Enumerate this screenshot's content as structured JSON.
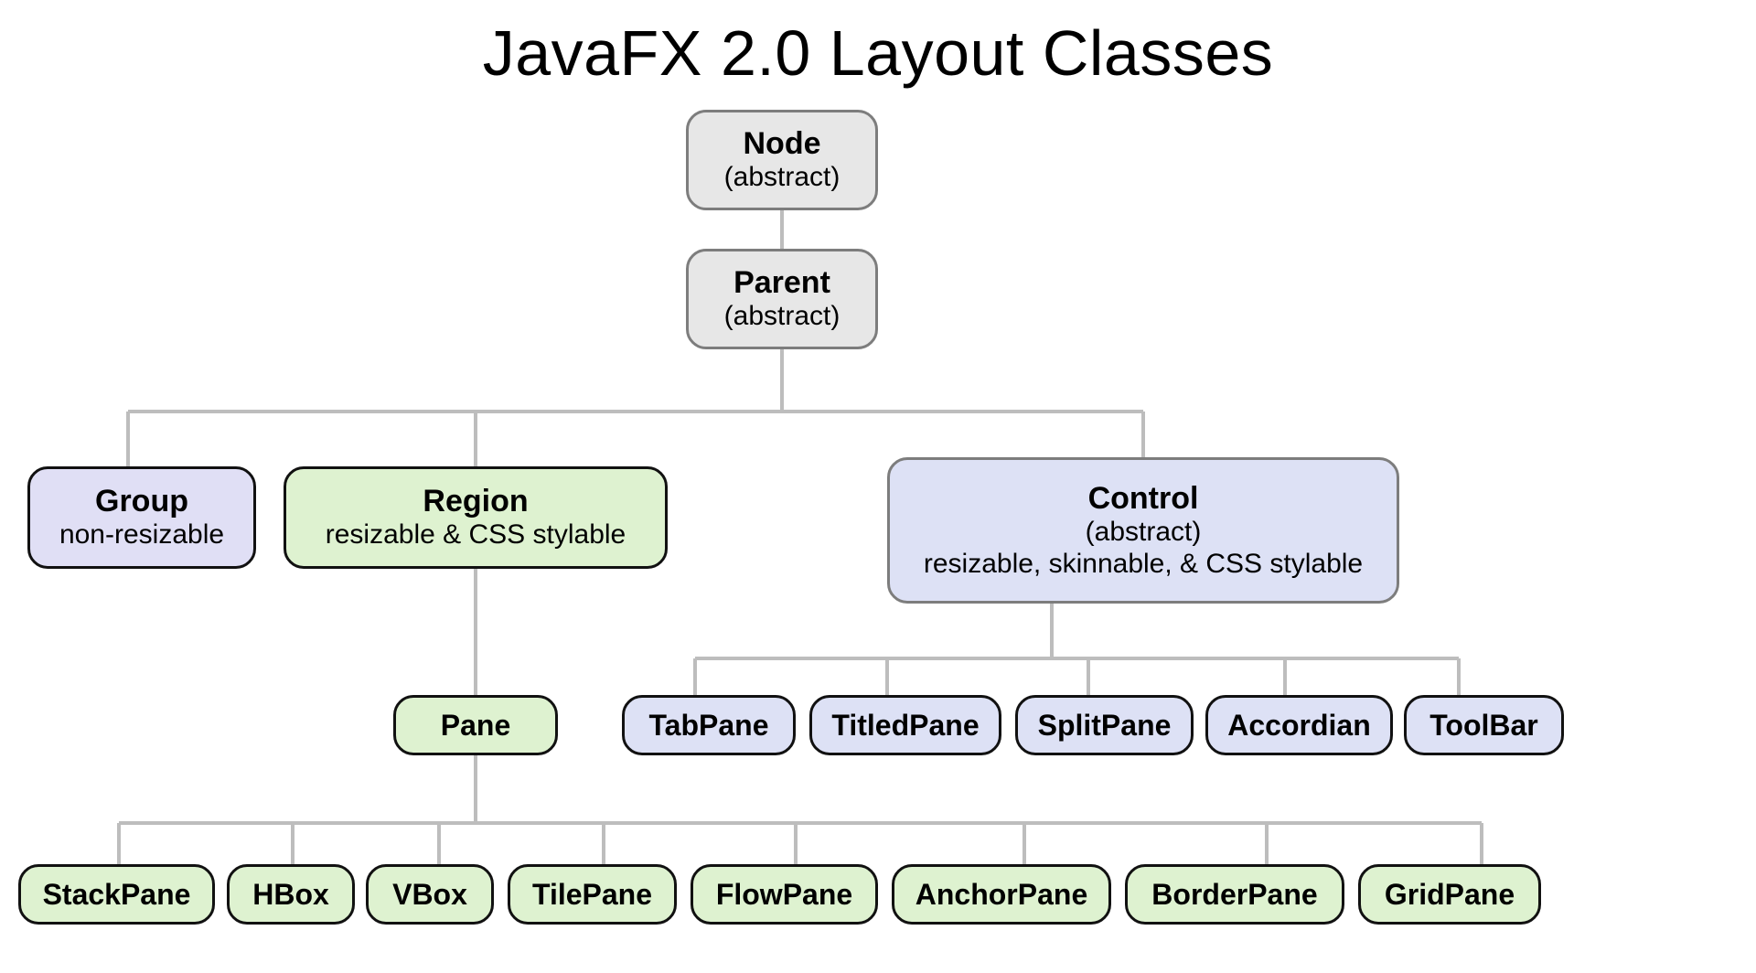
{
  "title": "JavaFX 2.0 Layout Classes",
  "nodes": {
    "node": {
      "name": "Node",
      "sub": "(abstract)"
    },
    "parent": {
      "name": "Parent",
      "sub": "(abstract)"
    },
    "group": {
      "name": "Group",
      "sub": "non-resizable"
    },
    "region": {
      "name": "Region",
      "sub": "resizable & CSS stylable"
    },
    "control": {
      "name": "Control",
      "sub": "(abstract)",
      "sub2": "resizable, skinnable, & CSS stylable"
    },
    "pane": {
      "name": "Pane"
    },
    "controlChildren": [
      {
        "name": "TabPane"
      },
      {
        "name": "TitledPane"
      },
      {
        "name": "SplitPane"
      },
      {
        "name": "Accordian"
      },
      {
        "name": "ToolBar"
      }
    ],
    "paneChildren": [
      {
        "name": "StackPane"
      },
      {
        "name": "HBox"
      },
      {
        "name": "VBox"
      },
      {
        "name": "TilePane"
      },
      {
        "name": "FlowPane"
      },
      {
        "name": "AnchorPane"
      },
      {
        "name": "BorderPane"
      },
      {
        "name": "GridPane"
      }
    ]
  },
  "colors": {
    "abstract": "#e7e7e7",
    "lavender": "#e0dff5",
    "blue": "#dde1f5",
    "green": "#def2d0",
    "line": "#bdbdbd"
  },
  "chart_data": {
    "type": "tree",
    "title": "JavaFX 2.0 Layout Classes",
    "root": {
      "name": "Node",
      "note": "abstract",
      "children": [
        {
          "name": "Parent",
          "note": "abstract",
          "children": [
            {
              "name": "Group",
              "note": "non-resizable"
            },
            {
              "name": "Region",
              "note": "resizable & CSS stylable",
              "children": [
                {
                  "name": "Pane",
                  "children": [
                    {
                      "name": "StackPane"
                    },
                    {
                      "name": "HBox"
                    },
                    {
                      "name": "VBox"
                    },
                    {
                      "name": "TilePane"
                    },
                    {
                      "name": "FlowPane"
                    },
                    {
                      "name": "AnchorPane"
                    },
                    {
                      "name": "BorderPane"
                    },
                    {
                      "name": "GridPane"
                    }
                  ]
                }
              ]
            },
            {
              "name": "Control",
              "note": "abstract; resizable, skinnable, & CSS stylable",
              "children": [
                {
                  "name": "TabPane"
                },
                {
                  "name": "TitledPane"
                },
                {
                  "name": "SplitPane"
                },
                {
                  "name": "Accordian"
                },
                {
                  "name": "ToolBar"
                }
              ]
            }
          ]
        }
      ]
    }
  }
}
